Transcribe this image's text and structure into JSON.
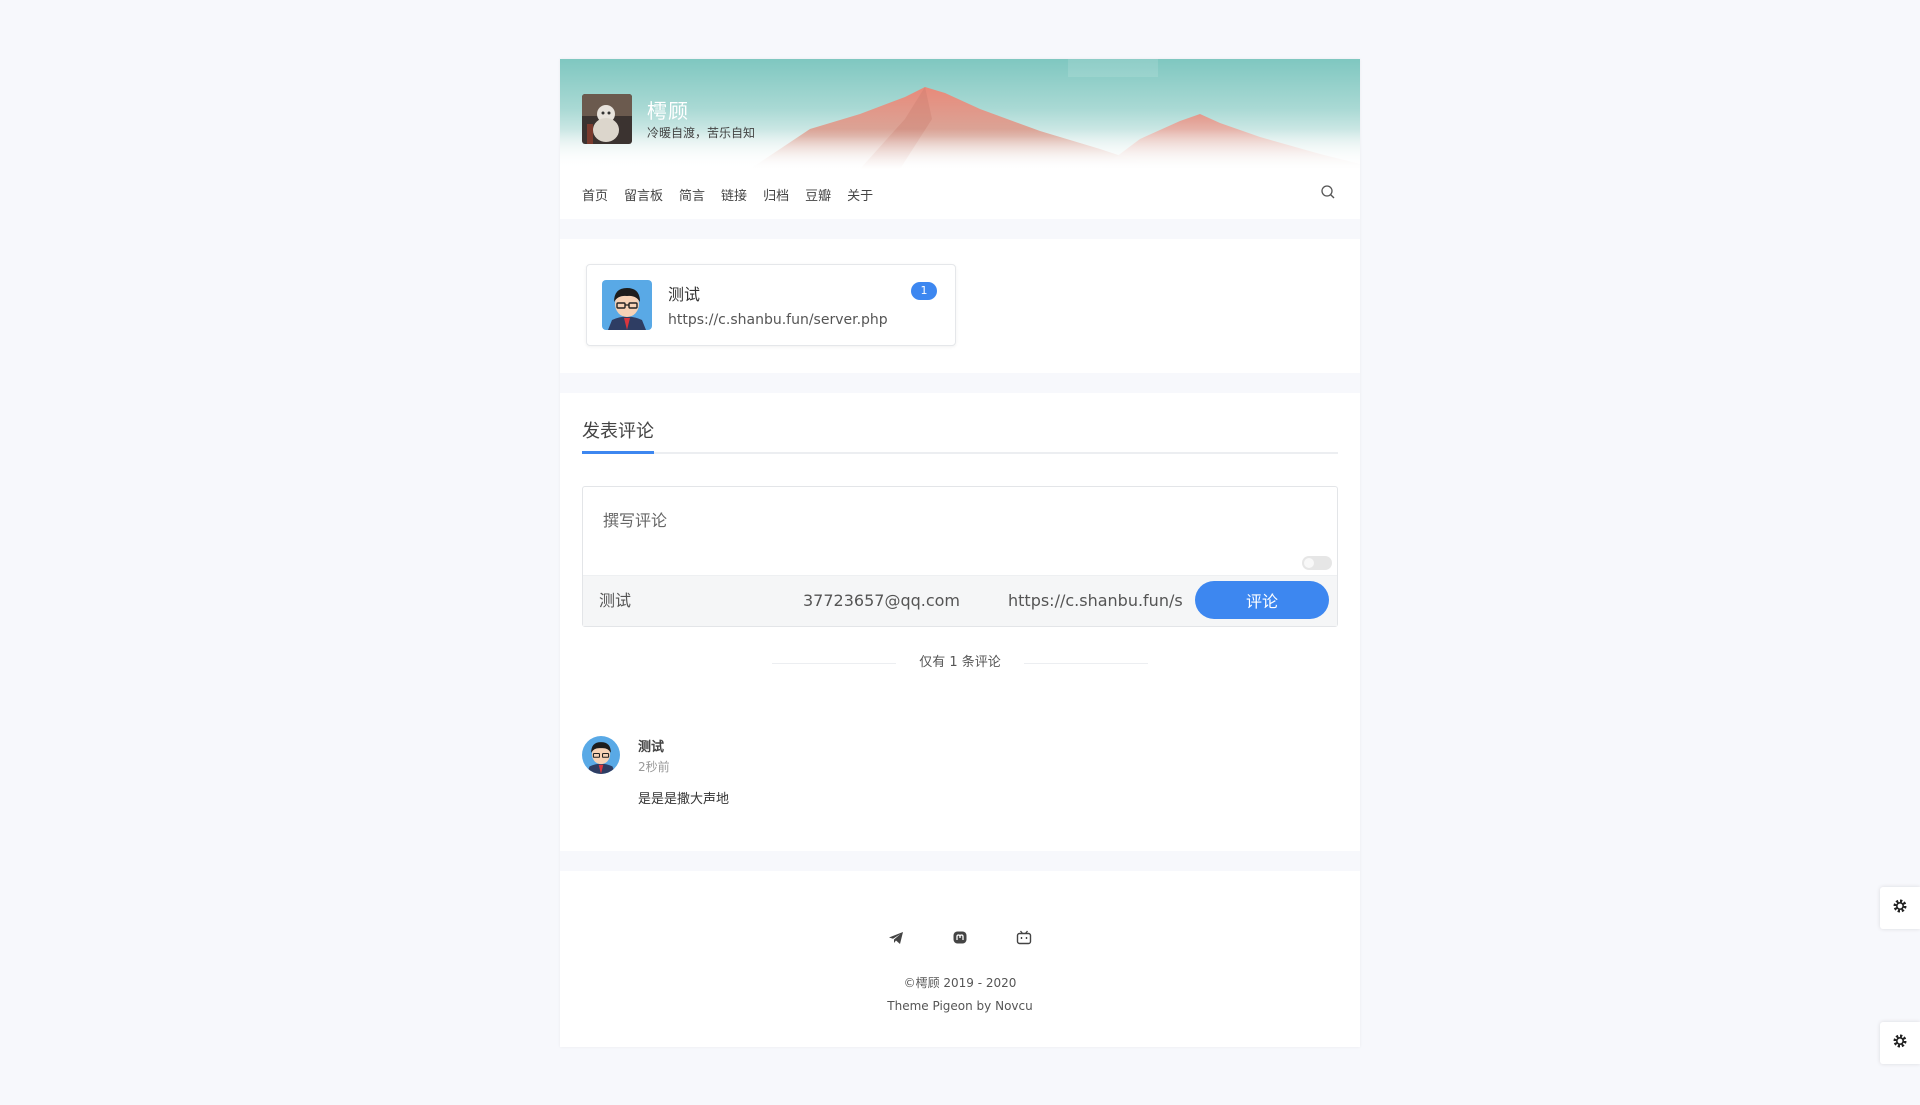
{
  "site": {
    "title": "樗顾",
    "description": "冷暖自渡，苦乐自知"
  },
  "nav": {
    "items": [
      "首页",
      "留言板",
      "简言",
      "链接",
      "归档",
      "豆瓣",
      "关于"
    ],
    "search_icon": "search-icon"
  },
  "link_card": {
    "name": "测试",
    "url": "https://c.shanbu.fun/server.php",
    "badge": "1"
  },
  "comment_section": {
    "title": "发表评论",
    "textarea_placeholder": "撰写评论",
    "name_value": "测试",
    "email_value": "37723657@qq.com",
    "website_value": "https://c.shanbu.fun/server.php",
    "submit_label": "评论",
    "count_text": "仅有 1 条评论"
  },
  "comments": [
    {
      "author": "测试",
      "time": "2秒前",
      "content": "是是是撒大声地"
    }
  ],
  "footer": {
    "icons": [
      "telegram-icon",
      "mastodon-icon",
      "bilibili-icon"
    ],
    "copyright": "©樗顾 2019 - 2020",
    "theme": "Theme Pigeon by Novcu"
  },
  "colors": {
    "accent": "#3d87f0",
    "page_bg": "#f7f8fc"
  }
}
